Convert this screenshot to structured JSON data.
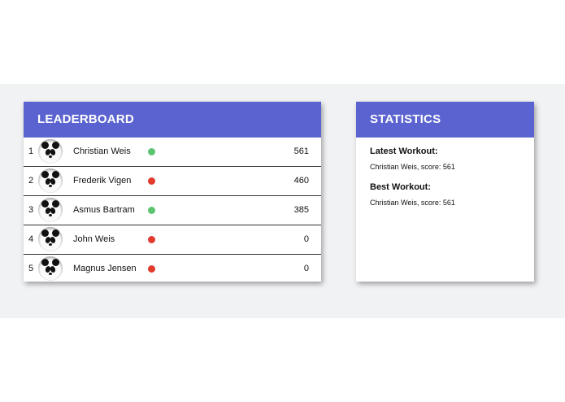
{
  "colors": {
    "header": "#5a63cf",
    "active": "#5cc46e",
    "inactive": "#e23b2e",
    "background_band": "#f1f2f4"
  },
  "leaderboard": {
    "title": "LEADERBOARD",
    "rows": [
      {
        "rank": "1",
        "name": "Christian Weis",
        "status": "active",
        "score": "561",
        "avatar": "panda-avatar"
      },
      {
        "rank": "2",
        "name": "Frederik Vigen",
        "status": "inactive",
        "score": "460",
        "avatar": "panda-avatar"
      },
      {
        "rank": "3",
        "name": "Asmus Bartram",
        "status": "active",
        "score": "385",
        "avatar": "panda-avatar"
      },
      {
        "rank": "4",
        "name": "John Weis",
        "status": "inactive",
        "score": "0",
        "avatar": "panda-avatar"
      },
      {
        "rank": "5",
        "name": "Magnus Jensen",
        "status": "inactive",
        "score": "0",
        "avatar": "panda-avatar"
      }
    ]
  },
  "statistics": {
    "title": "STATISTICS",
    "latest_label": "Latest Workout:",
    "latest_value": "Christian Weis, score: 561",
    "best_label": "Best Workout:",
    "best_value": "Christian Weis, score: 561"
  }
}
